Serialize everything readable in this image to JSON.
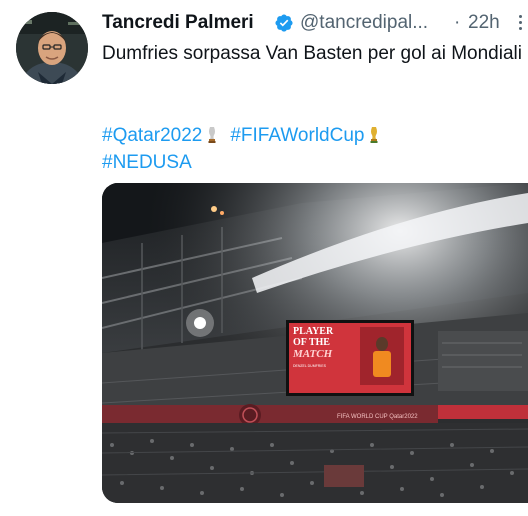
{
  "tweet": {
    "author_name": "Tancredi Palmeri",
    "handle": "@tancredipal...",
    "separator": "·",
    "time": "22h",
    "text": "Dumfries sorpassa Van Basten per gol ai Mondiali",
    "hashtags": [
      "#Qatar2022",
      "#FIFAWorldCup",
      "#NEDUSA"
    ]
  },
  "media": {
    "screen_title_1": "PLAYER",
    "screen_title_2": "OF THE",
    "screen_title_3": "MATCH",
    "screen_player": "DENZEL DUMFRIES",
    "banner_text": "FIFA WORLD CUP Qatar2022"
  },
  "colors": {
    "link": "#1d9bf0",
    "verified": "#1d9bf0",
    "secondary_text": "#536471",
    "screen_red": "#d0343c"
  },
  "icons": {
    "verified": "verified-badge-icon",
    "more": "more-dots-icon",
    "trophy": "trophy-icon"
  }
}
